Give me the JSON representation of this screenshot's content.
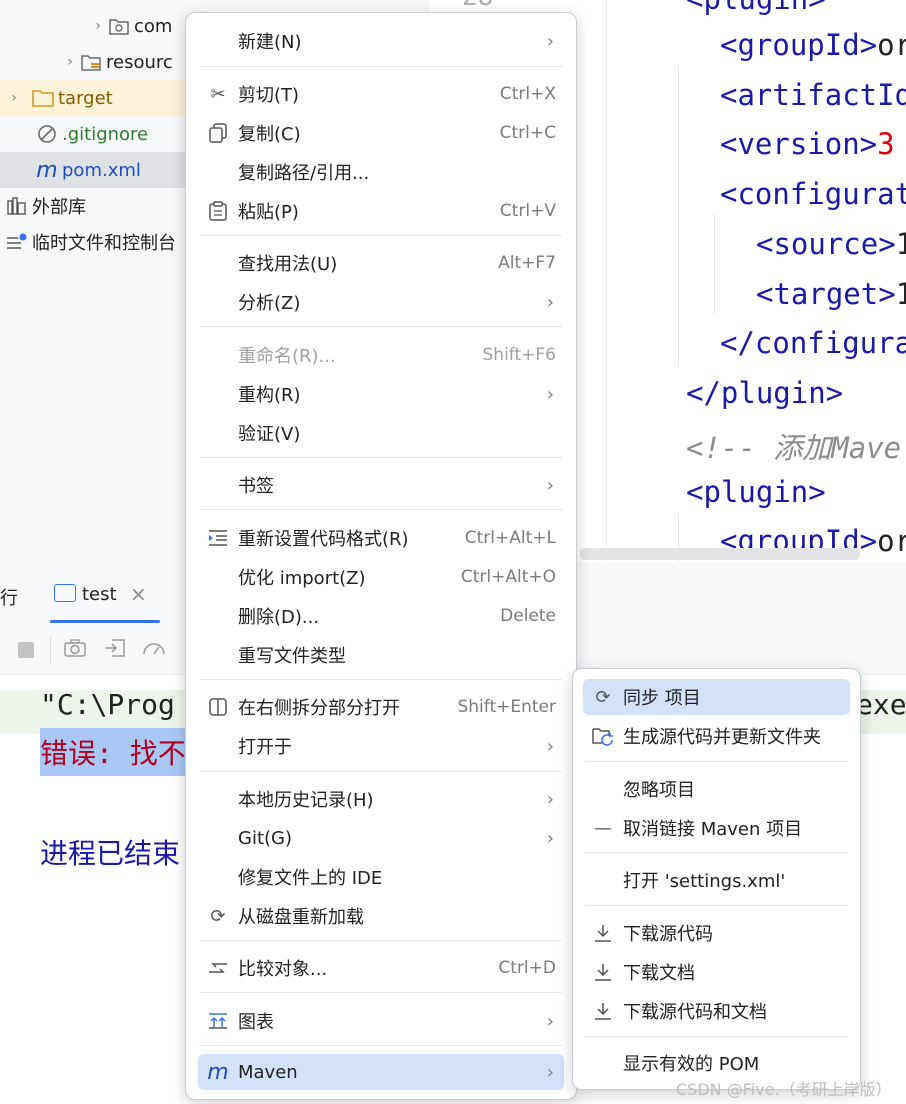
{
  "tree": {
    "items": [
      {
        "label": "com",
        "icon": "package-folder-icon",
        "color": "#222222"
      },
      {
        "label": "resourc",
        "icon": "resources-folder-icon",
        "color": "#222222"
      },
      {
        "label": "target",
        "icon": "folder-icon",
        "color": "#8a5a00"
      },
      {
        "label": ".gitignore",
        "icon": "gitignore-icon",
        "color": "#2e7d32"
      },
      {
        "label": "pom.xml",
        "icon": "maven-icon",
        "color": "#1f4fbf"
      },
      {
        "label": "外部库",
        "icon": "library-icon",
        "color": "#222222"
      },
      {
        "label": "临时文件和控制台",
        "icon": "scratch-icon",
        "color": "#222222"
      }
    ]
  },
  "editor": {
    "line_number": "28",
    "lines": [
      {
        "open": "<plugin>",
        "text": "",
        "close": ""
      },
      {
        "open": "<groupId>",
        "text": "or",
        "close": ""
      },
      {
        "open": "<artifactId",
        "text": "",
        "close": ""
      },
      {
        "open": "<version>",
        "text": "3",
        "close": ""
      },
      {
        "open": "<configurat",
        "text": "",
        "close": ""
      },
      {
        "open": "<source>",
        "text": "1",
        "close": ""
      },
      {
        "open": "<target>",
        "text": "1",
        "close": ""
      },
      {
        "open": "</configura",
        "text": "",
        "close": ""
      },
      {
        "open": "</plugin>",
        "text": "",
        "close": ""
      },
      {
        "open": "<!-- 添加Mave",
        "text": "",
        "close": ""
      },
      {
        "open": "<plugin>",
        "text": "",
        "close": ""
      },
      {
        "open": "<groupId>",
        "text": "or",
        "close": ""
      }
    ]
  },
  "run": {
    "left_tab": "行",
    "tab_label": "test",
    "console": {
      "line1": "\"C:\\Prog",
      "line1_right": "exe",
      "line2": "错误: 找不",
      "line3": "进程已结束"
    }
  },
  "context_menu": {
    "items": [
      {
        "label": "新建(N)",
        "shortcut": "",
        "submenu": true,
        "icon": ""
      },
      {
        "label": "剪切(T)",
        "shortcut": "Ctrl+X",
        "submenu": false,
        "icon": "scissors-icon"
      },
      {
        "label": "复制(C)",
        "shortcut": "Ctrl+C",
        "submenu": false,
        "icon": "copy-icon"
      },
      {
        "label": "复制路径/引用...",
        "shortcut": "",
        "submenu": false,
        "icon": ""
      },
      {
        "label": "粘贴(P)",
        "shortcut": "Ctrl+V",
        "submenu": false,
        "icon": "paste-icon"
      },
      {
        "label": "查找用法(U)",
        "shortcut": "Alt+F7",
        "submenu": false,
        "icon": ""
      },
      {
        "label": "分析(Z)",
        "shortcut": "",
        "submenu": true,
        "icon": ""
      },
      {
        "label": "重命名(R)...",
        "shortcut": "Shift+F6",
        "submenu": false,
        "icon": "",
        "disabled": true
      },
      {
        "label": "重构(R)",
        "shortcut": "",
        "submenu": true,
        "icon": ""
      },
      {
        "label": "验证(V)",
        "shortcut": "",
        "submenu": false,
        "icon": ""
      },
      {
        "label": "书签",
        "shortcut": "",
        "submenu": true,
        "icon": ""
      },
      {
        "label": "重新设置代码格式(R)",
        "shortcut": "Ctrl+Alt+L",
        "submenu": false,
        "icon": "reformat-icon"
      },
      {
        "label": "优化 import(Z)",
        "shortcut": "Ctrl+Alt+O",
        "submenu": false,
        "icon": ""
      },
      {
        "label": "删除(D)...",
        "shortcut": "Delete",
        "submenu": false,
        "icon": ""
      },
      {
        "label": "重写文件类型",
        "shortcut": "",
        "submenu": false,
        "icon": ""
      },
      {
        "label": "在右侧拆分部分打开",
        "shortcut": "Shift+Enter",
        "submenu": false,
        "icon": "split-icon"
      },
      {
        "label": "打开于",
        "shortcut": "",
        "submenu": true,
        "icon": ""
      },
      {
        "label": "本地历史记录(H)",
        "shortcut": "",
        "submenu": true,
        "icon": ""
      },
      {
        "label": "Git(G)",
        "shortcut": "",
        "submenu": true,
        "icon": ""
      },
      {
        "label": "修复文件上的 IDE",
        "shortcut": "",
        "submenu": false,
        "icon": ""
      },
      {
        "label": "从磁盘重新加载",
        "shortcut": "",
        "submenu": false,
        "icon": "reload-icon"
      },
      {
        "label": "比较对象...",
        "shortcut": "Ctrl+D",
        "submenu": false,
        "icon": "compare-icon"
      },
      {
        "label": "图表",
        "shortcut": "",
        "submenu": true,
        "icon": "diagram-icon"
      },
      {
        "label": "Maven",
        "shortcut": "",
        "submenu": true,
        "icon": "maven-icon",
        "highlighted": true
      }
    ]
  },
  "maven_menu": {
    "items": [
      {
        "label": "同步 项目",
        "icon": "sync-icon",
        "highlighted": true
      },
      {
        "label": "生成源代码并更新文件夹",
        "icon": "generate-sources-icon"
      },
      {
        "label": "忽略项目",
        "icon": ""
      },
      {
        "label": "取消链接 Maven 项目",
        "icon": "unlink-icon"
      },
      {
        "label": "打开 'settings.xml'",
        "icon": ""
      },
      {
        "label": "下载源代码",
        "icon": "download-icon"
      },
      {
        "label": "下载文档",
        "icon": "download-icon"
      },
      {
        "label": "下载源代码和文档",
        "icon": "download-icon"
      },
      {
        "label": "显示有效的 POM",
        "icon": ""
      }
    ]
  },
  "watermark": "CSDN @Five.（考研上岸版）",
  "colors": {
    "highlight": "#d3e1fb",
    "tag": "#1a1aa6",
    "error_bg": "#a9c8f5",
    "error_text": "#b00020"
  }
}
